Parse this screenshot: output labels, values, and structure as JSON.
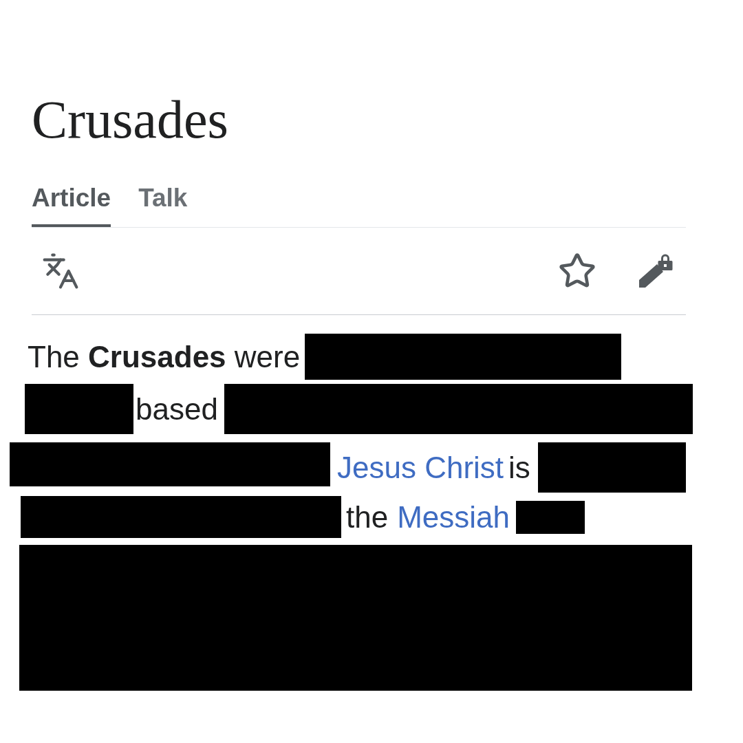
{
  "page": {
    "title": "Crusades"
  },
  "tabs": [
    {
      "label": "Article",
      "selected": true
    },
    {
      "label": "Talk",
      "selected": false
    }
  ],
  "body": {
    "lines": [
      [
        {
          "kind": "text",
          "text": "The **Crusades** were"
        },
        {
          "kind": "redaction"
        }
      ],
      [
        {
          "kind": "redaction"
        },
        {
          "kind": "text",
          "text": "based"
        },
        {
          "kind": "redaction"
        }
      ],
      [
        {
          "kind": "redaction"
        },
        {
          "kind": "link",
          "text": "Jesus Christ"
        },
        {
          "kind": "text",
          "text": "is"
        },
        {
          "kind": "redaction"
        }
      ],
      [
        {
          "kind": "redaction"
        },
        {
          "kind": "text",
          "text": "the"
        },
        {
          "kind": "link",
          "text": "Messiah"
        },
        {
          "kind": "redaction"
        }
      ],
      [
        {
          "kind": "redaction"
        }
      ]
    ]
  }
}
